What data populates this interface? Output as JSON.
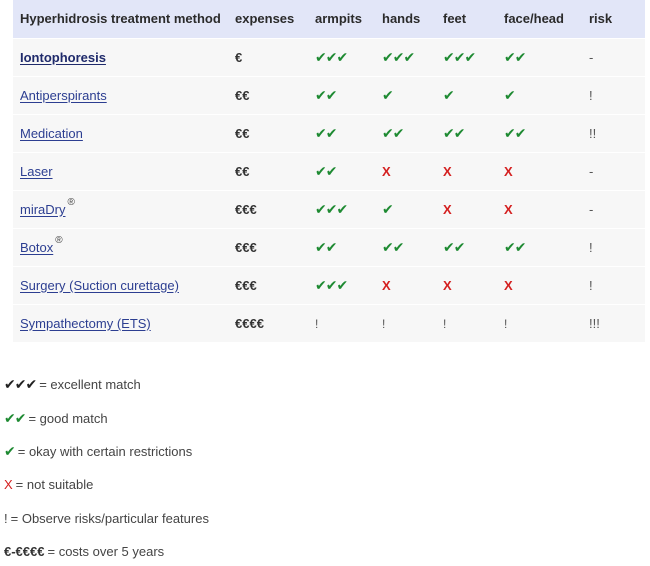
{
  "table": {
    "headers": [
      "Hyperhidrosis treatment method",
      "expenses",
      "armpits",
      "hands",
      "feet",
      "face/head",
      "risk"
    ],
    "rows": [
      {
        "name": "Iontophoresis",
        "bold": true,
        "sup": "",
        "expenses": "€",
        "armpits": "✔✔✔",
        "hands": "✔✔✔",
        "feet": "✔✔✔",
        "face": "✔✔",
        "risk": "-"
      },
      {
        "name": "Antiperspirants",
        "bold": false,
        "sup": "",
        "expenses": "€€",
        "armpits": "✔✔",
        "hands": "✔",
        "feet": "✔",
        "face": "✔",
        "risk": "!"
      },
      {
        "name": "Medication",
        "bold": false,
        "sup": "",
        "expenses": "€€",
        "armpits": "✔✔",
        "hands": "✔✔",
        "feet": "✔✔",
        "face": "✔✔",
        "risk": "!!"
      },
      {
        "name": "Laser",
        "bold": false,
        "sup": "",
        "expenses": "€€",
        "armpits": "✔✔",
        "hands": "X",
        "feet": "X",
        "face": "X",
        "risk": "-"
      },
      {
        "name": "miraDry",
        "bold": false,
        "sup": "®",
        "expenses": "€€€",
        "armpits": "✔✔✔",
        "hands": "✔",
        "feet": "X",
        "face": "X",
        "risk": "-"
      },
      {
        "name": "Botox",
        "bold": false,
        "sup": "®",
        "expenses": "€€€",
        "armpits": "✔✔",
        "hands": "✔✔",
        "feet": "✔✔",
        "face": "✔✔",
        "risk": "!"
      },
      {
        "name": "Surgery (Suction curettage)",
        "bold": false,
        "sup": "",
        "expenses": "€€€",
        "armpits": "✔✔✔",
        "hands": "X",
        "feet": "X",
        "face": "X",
        "risk": "!"
      },
      {
        "name": "Sympathectomy (ETS)",
        "bold": false,
        "sup": "",
        "expenses": "€€€€",
        "armpits": "!",
        "hands": "!",
        "feet": "!",
        "face": "!",
        "risk": "!!!"
      }
    ]
  },
  "legend": [
    {
      "symbol": "✔✔✔",
      "style": "dark",
      "text": "= excellent match"
    },
    {
      "symbol": "✔✔",
      "style": "green",
      "text": "= good match"
    },
    {
      "symbol": "✔",
      "style": "green",
      "text": "= okay with certain restrictions"
    },
    {
      "symbol": "X",
      "style": "red",
      "text": "= not suitable"
    },
    {
      "symbol": "!",
      "style": "plain",
      "text": "= Observe risks/particular features"
    },
    {
      "symbol": "€-€€€€",
      "style": "boldcost",
      "text": "= costs over 5 years"
    }
  ],
  "colors": {
    "check": "#1e8a32",
    "cross": "#d42020",
    "header_bg": "#e2e6f8",
    "row_bg": "#f7f7f7",
    "link": "#2c3e91"
  }
}
